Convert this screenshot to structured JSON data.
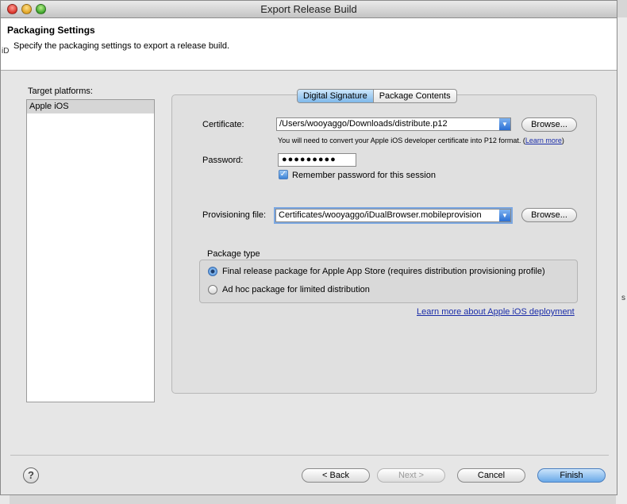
{
  "window": {
    "title": "Export Release Build"
  },
  "header": {
    "title": "Packaging Settings",
    "description": "Specify the packaging settings to export a release build."
  },
  "background": {
    "leak_iD": "iD",
    "leak_s": "s"
  },
  "platforms": {
    "label": "Target platforms:",
    "items": [
      {
        "label": "Apple iOS",
        "selected": true
      }
    ]
  },
  "tabs": [
    {
      "label": "Digital Signature",
      "active": true
    },
    {
      "label": "Package Contents",
      "active": false
    }
  ],
  "certificate": {
    "label": "Certificate:",
    "value": "/Users/wooyaggo/Downloads/distribute.p12",
    "browse_label": "Browse...",
    "note": "You will need to convert your Apple iOS developer certificate into P12 format. (",
    "note_link": "Learn more",
    "note_end": ")"
  },
  "password": {
    "label": "Password:",
    "value": "●●●●●●●●●",
    "remember_label": "Remember password for this session",
    "remember_checked": true
  },
  "provisioning": {
    "label": "Provisioning file:",
    "value": "Certificates/wooyaggo/iDualBrowser.mobileprovision",
    "browse_label": "Browse..."
  },
  "package_type": {
    "title": "Package type",
    "options": [
      {
        "label": "Final release package for Apple App Store (requires distribution provisioning profile)",
        "selected": true
      },
      {
        "label": "Ad hoc package for limited distribution",
        "selected": false
      }
    ],
    "learn_more": "Learn more about Apple iOS deployment"
  },
  "footer": {
    "help_label": "?",
    "back_label": "< Back",
    "next_label": "Next >",
    "cancel_label": "Cancel",
    "finish_label": "Finish"
  },
  "colors": {
    "accent": "#6aa9e8",
    "link": "#1a2ca8",
    "selection": "#d6d6d6"
  }
}
